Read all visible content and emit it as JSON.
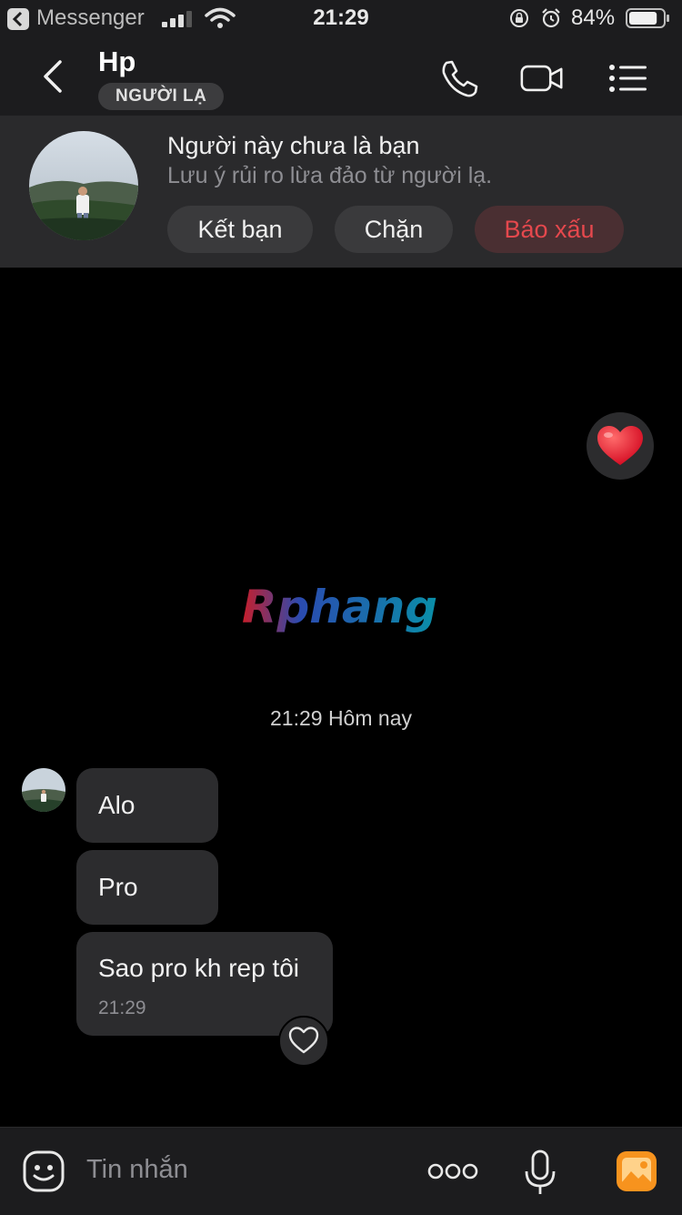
{
  "status_bar": {
    "app_name": "Messenger",
    "time": "21:29",
    "battery": "84%",
    "battery_level": 0.84
  },
  "header": {
    "title": "Hp",
    "badge": "NGƯỜI LẠ"
  },
  "banner": {
    "title": "Người này chưa là bạn",
    "subtitle": "Lưu ý rủi ro lừa đảo từ người lạ.",
    "add_friend_label": "Kết bạn",
    "block_label": "Chặn",
    "report_label": "Báo xấu"
  },
  "chat": {
    "watermark": "Rphang",
    "date_divider": "21:29 Hôm nay",
    "messages": [
      {
        "text": "Alo"
      },
      {
        "text": "Pro"
      },
      {
        "text": "Sao pro kh rep tôi",
        "time": "21:29"
      }
    ]
  },
  "input": {
    "placeholder": "Tin nhắn"
  },
  "colors": {
    "background": "#000000",
    "bar": "#1c1c1e",
    "bubble": "#2c2c2e",
    "report": "#e5484d",
    "image_button": "#f7931e"
  }
}
